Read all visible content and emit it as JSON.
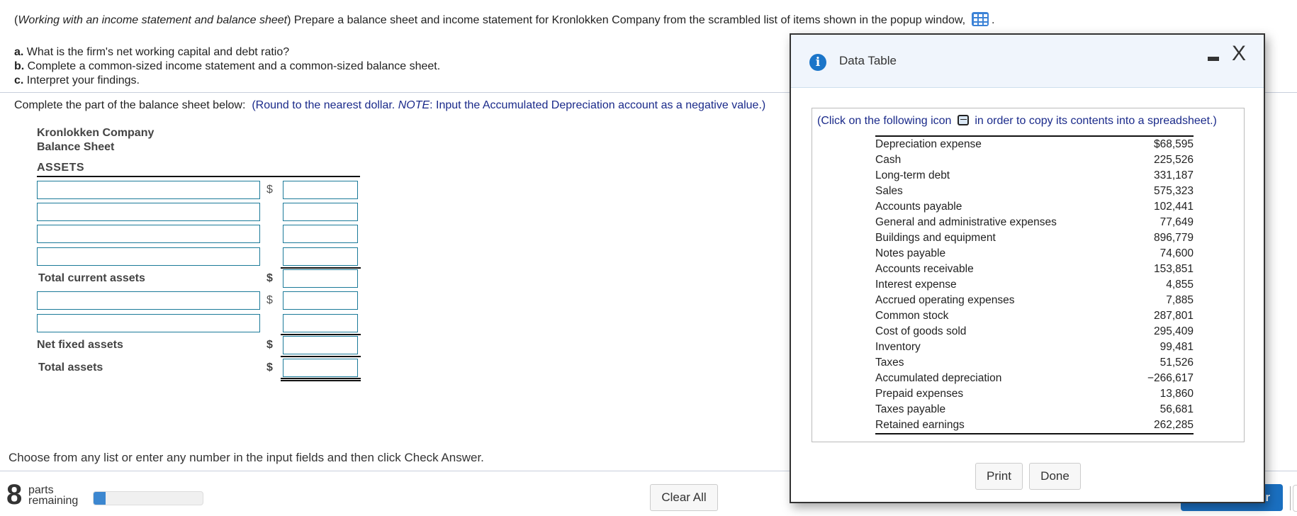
{
  "question": {
    "intro_italic": "Working with an income statement and balance sheet",
    "intro_rest": ") Prepare a balance sheet and income statement for Kronlokken Company from the scrambled list of items shown in the popup window,",
    "intro_open": "(",
    "intro_end": ".",
    "parts": [
      {
        "letter": "a.",
        "text": " What is the firm's net working capital and debt ratio?"
      },
      {
        "letter": "b.",
        "text": " Complete a common-sized income statement and a common-sized balance sheet."
      },
      {
        "letter": "c.",
        "text": " Interpret your findings."
      }
    ]
  },
  "instructions": {
    "lead": "Complete the part of the balance sheet below:",
    "note_open": "(Round to the nearest dollar. ",
    "note_italic": "NOTE",
    "note_rest": ": Input the Accumulated Depreciation  account as a negative value.)"
  },
  "balance_sheet": {
    "company": "Kronlokken Company",
    "title": "Balance Sheet",
    "section": "ASSETS",
    "currency_symbol": "$",
    "labels": {
      "total_current_assets": "Total current assets",
      "net_fixed_assets": "Net fixed assets",
      "total_assets": "Total assets"
    },
    "inputs": {
      "current_names": [
        "",
        "",
        "",
        ""
      ],
      "current_values": [
        "",
        "",
        "",
        ""
      ],
      "total_current_assets": "",
      "fixed_names": [
        "",
        ""
      ],
      "fixed_values": [
        "",
        ""
      ],
      "net_fixed_assets": "",
      "total_assets": ""
    }
  },
  "footer": {
    "message": "Choose from any list or enter any number in the input fields and then click Check Answer.",
    "parts_remaining_count": "8",
    "parts_label_1": "parts",
    "parts_label_2": "remaining",
    "progress_fraction": 0.11,
    "clear_all": "Clear All",
    "check_answer": "Check Answer"
  },
  "popup": {
    "title": "Data Table",
    "copy_note_before": "(Click on the following icon",
    "copy_note_after": "in order to copy its contents into a spreadsheet.)",
    "rows": [
      {
        "item": "Depreciation expense",
        "value": "$68,595"
      },
      {
        "item": "Cash",
        "value": "225,526"
      },
      {
        "item": "Long-term debt",
        "value": "331,187"
      },
      {
        "item": "Sales",
        "value": "575,323"
      },
      {
        "item": "Accounts payable",
        "value": "102,441"
      },
      {
        "item": "General and administrative expenses",
        "value": "77,649"
      },
      {
        "item": "Buildings and equipment",
        "value": "896,779"
      },
      {
        "item": "Notes payable",
        "value": "74,600"
      },
      {
        "item": "Accounts receivable",
        "value": "153,851"
      },
      {
        "item": "Interest expense",
        "value": "4,855"
      },
      {
        "item": "Accrued operating expenses",
        "value": "7,885"
      },
      {
        "item": "Common stock",
        "value": "287,801"
      },
      {
        "item": "Cost of goods sold",
        "value": "295,409"
      },
      {
        "item": "Inventory",
        "value": "99,481"
      },
      {
        "item": "Taxes",
        "value": "51,526"
      },
      {
        "item": "Accumulated depreciation",
        "value": "−266,617"
      },
      {
        "item": "Prepaid expenses",
        "value": "13,860"
      },
      {
        "item": "Taxes payable",
        "value": "56,681"
      },
      {
        "item": "Retained earnings",
        "value": "262,285"
      }
    ],
    "print": "Print",
    "done": "Done"
  },
  "colors": {
    "accent_blue": "#1b75c9",
    "input_border": "#1b7a99",
    "instruction_blue": "#1a2a8a",
    "check_button": "#1a6fc0"
  }
}
